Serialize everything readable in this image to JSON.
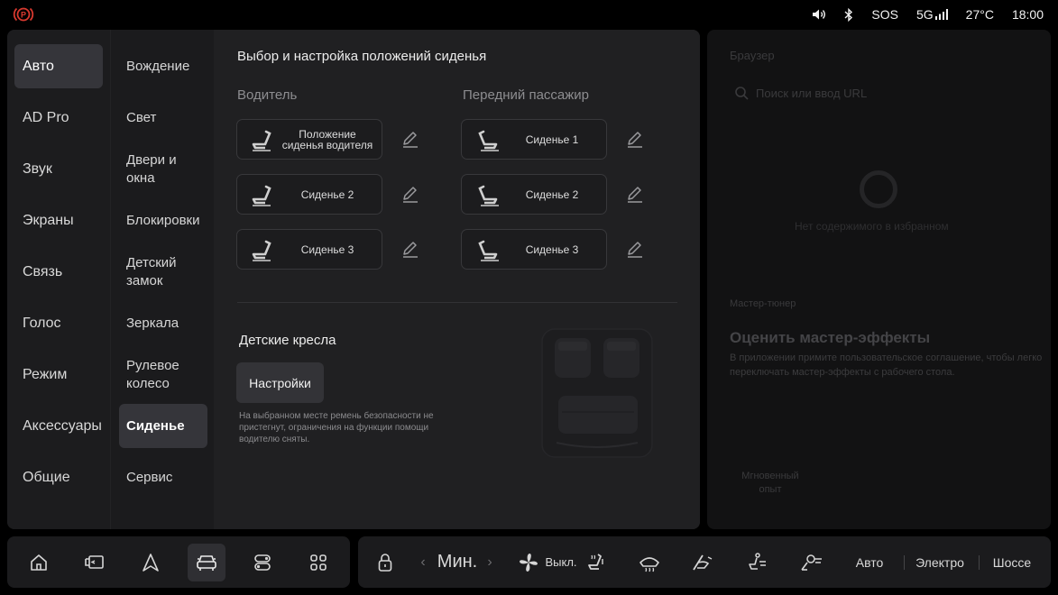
{
  "status_bar": {
    "brake_icon": "parking-brake-icon",
    "volume_icon": "volume-icon",
    "bluetooth_icon": "bluetooth-icon",
    "sos": "SOS",
    "network": "5G",
    "temperature": "27°C",
    "time": "18:00",
    "accent_color": "#d9392f"
  },
  "nav_primary": [
    {
      "label": "Авто",
      "active": true
    },
    {
      "label": "AD Pro"
    },
    {
      "label": "Звук"
    },
    {
      "label": "Экраны"
    },
    {
      "label": "Связь"
    },
    {
      "label": "Голос"
    },
    {
      "label": "Режим"
    },
    {
      "label": "Аксессуары"
    },
    {
      "label": "Общие"
    }
  ],
  "nav_secondary": [
    {
      "label": "Вождение"
    },
    {
      "label": "Свет"
    },
    {
      "label": "Двери и окна"
    },
    {
      "label": "Блокировки"
    },
    {
      "label": "Детский замок"
    },
    {
      "label": "Зеркала"
    },
    {
      "label": "Рулевое колесо"
    },
    {
      "label": "Сиденье",
      "active": true
    },
    {
      "label": "Сервис"
    }
  ],
  "content": {
    "title": "Выбор и настройка положений сиденья",
    "driver": {
      "label": "Водитель",
      "seats": [
        "Положение сиденья водителя",
        "Сиденье 2",
        "Сиденье 3"
      ]
    },
    "passenger": {
      "label": "Передний пассажир",
      "seats": [
        "Сиденье 1",
        "Сиденье 2",
        "Сиденье 3"
      ]
    },
    "child_seats": {
      "title": "Детские кресла",
      "button": "Настройки",
      "note": "На выбранном месте ремень безопасности не пристегнут, ограничения на функции помощи водителю сняты."
    }
  },
  "right_panel": {
    "browser_title": "Браузер",
    "search_placeholder": "Поиск или ввод URL",
    "empty_text": "Нет содержимого в избранном",
    "tuner_label": "Мастер-тюнер",
    "tuner_title": "Оценить мастер-эффекты",
    "tuner_desc": "В приложении примите пользовательское соглашение, чтобы легко переключать мастер-эффекты с рабочего стола.",
    "instant": "Мгновенный опыт"
  },
  "dock": {
    "apps": [
      "home-icon",
      "screen-mirror-icon",
      "navigation-icon",
      "car-icon",
      "controls-icon",
      "apps-grid-icon"
    ],
    "active_app": "car-icon",
    "temperature": "Мин.",
    "fan": "Выкл.",
    "modes": [
      "Авто",
      "Электро",
      "Шоссе"
    ]
  }
}
